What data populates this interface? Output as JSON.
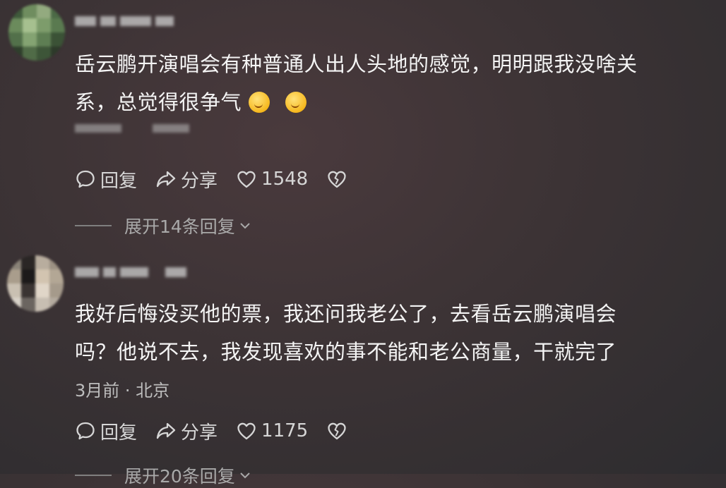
{
  "comments": [
    {
      "text_lines": [
        "岳云鹏开演唱会有种普通人出人头地的感觉，明明跟我没啥关",
        "系，总觉得很争气"
      ],
      "emoji": [
        "thinking-face-emoji",
        "thinking-face-emoji"
      ],
      "meta": "",
      "actions": {
        "reply": "回复",
        "share": "分享",
        "likes": "1548"
      },
      "expand": "展开14条回复"
    },
    {
      "text_lines": [
        "我好后悔没买他的票，我还问我老公了，去看岳云鹏演唱会",
        "吗？他说不去，我发现喜欢的事不能和老公商量，干就完了"
      ],
      "meta": "3月前 · 北京",
      "actions": {
        "reply": "回复",
        "share": "分享",
        "likes": "1175"
      },
      "expand": "展开20条回复"
    }
  ],
  "colors": {
    "text": "#f4f4f4",
    "meta": "#bdbdbd",
    "action": "#d6d6d6"
  }
}
